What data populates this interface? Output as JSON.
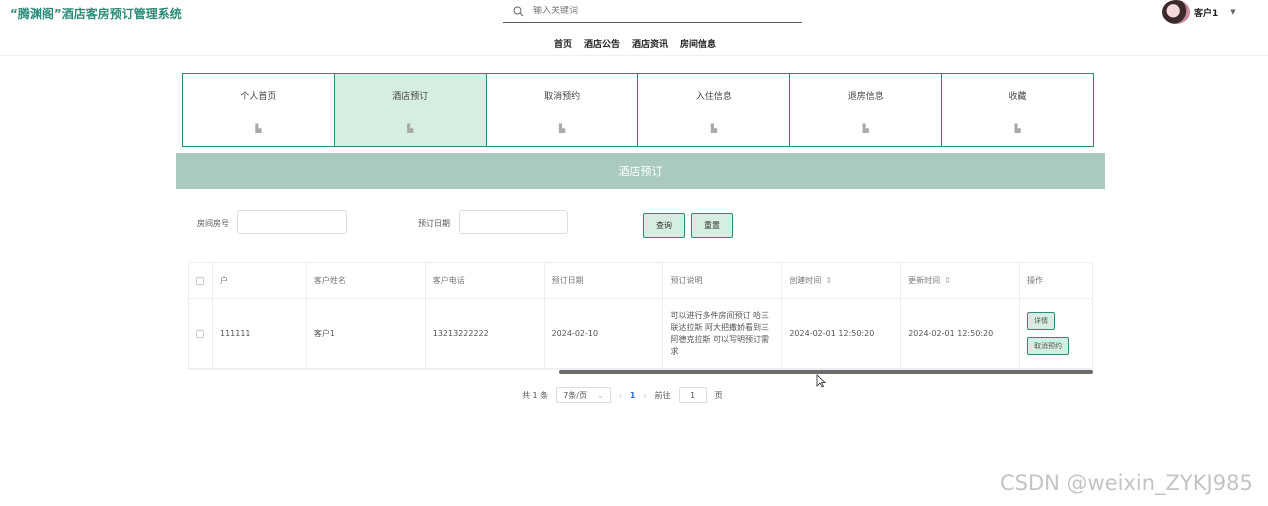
{
  "header": {
    "brand": "“腾渊阁”酒店客房预订管理系统",
    "search_placeholder": "输入关键词",
    "nav": [
      "首页",
      "酒店公告",
      "酒店资讯",
      "房间信息"
    ],
    "user_name": "客户1"
  },
  "menu": [
    {
      "label": "个人首页",
      "active": false
    },
    {
      "label": "酒店预订",
      "active": true
    },
    {
      "label": "取消预约",
      "active": false
    },
    {
      "label": "入住信息",
      "active": false
    },
    {
      "label": "退房信息",
      "active": false
    },
    {
      "label": "收藏",
      "active": false
    }
  ],
  "section_title": "酒店预订",
  "filters": {
    "room_no_label": "房间房号",
    "date_label": "预订日期",
    "query_button": "查询",
    "reset_button": "重置"
  },
  "table": {
    "headers": [
      "户",
      "客户姓名",
      "客户电话",
      "预订日期",
      "预订说明",
      "创建时间",
      "更新时间",
      "操作"
    ],
    "rows": [
      {
        "account": "111111",
        "name": "客户1",
        "phone": "13213222222",
        "date": "2024-02-10",
        "desc": "可以进行多件房间预订 哈三联达拉斯 阿大把撒娇看到三阿德克拉斯 可以写明预订需求",
        "created": "2024-02-01 12:50:20",
        "updated": "2024-02-01 12:50:20",
        "detail_button": "详情",
        "cancel_button": "取消预约"
      }
    ]
  },
  "pagination": {
    "total": "共 1 条",
    "page_size": "7条/页",
    "current_page": "1",
    "goto_label": "前往",
    "goto_value": "1",
    "page_unit": "页"
  },
  "watermark": "CSDN @weixin_ZYKJ985",
  "colors": {
    "accent": "#2e8b78",
    "accent_light": "#d6eee2",
    "section_bar": "#a9c9c1"
  }
}
